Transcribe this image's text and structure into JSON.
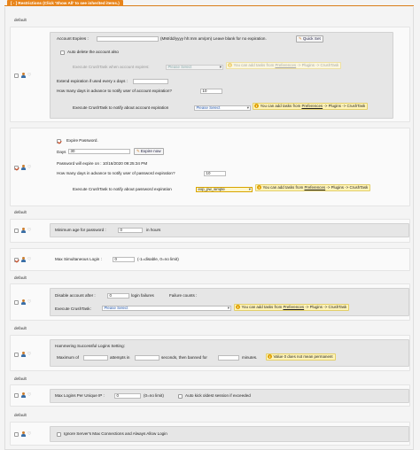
{
  "header": {
    "title": "[ - ] Restrictions (Click 'Show All' to see inherited items.)"
  },
  "labels": {
    "default": "default"
  },
  "expire": {
    "account_expires_label": "Account Expires :",
    "date_hint": "(MM/dd/yyyy hh:mm am/pm) Leave blank for no expiration.",
    "quick_set_label": "Quick Set",
    "auto_delete_label": "Auto delete the account also",
    "crushtask_when_expires_label": "Execute CrushTask when account expires:",
    "select_placeholder": "Please Select",
    "extend_label": "Extend expiration if used every x days :",
    "notify_days_label": "How many days in advance to notify user of account expiration?",
    "notify_days_value": "10",
    "crushtask_notify_label": "Execute CrushTask to notify about account expiration"
  },
  "tasks_note": {
    "pre": "You can add tasks from ",
    "link": "Preferences",
    "post": " -> Plugins -> CrushTask"
  },
  "password": {
    "expire_label": "Expire Password.",
    "days_label": "Days",
    "days_value": "30",
    "expire_now_label": "Expire now",
    "expire_on_text": "Password will expire on : 10/16/2020 09:25:34 PM",
    "notify_label": "How many days in advance to notify user of password expiration?",
    "notify_value": "10",
    "crushtask_label": "Execute CrushTask to notify about password expiration",
    "crushtask_value": "exp_pw_simple"
  },
  "min_age": {
    "label": "Minimum age for password :",
    "value": "0",
    "unit": "in hours"
  },
  "simultaneous": {
    "label": "Max Simultaneous Login :",
    "value": "0",
    "hint": "(-1=disable, 0=no limit)"
  },
  "disable": {
    "label": "Disable account after :",
    "value": "0",
    "suffix": "login failures",
    "failure_counts_label": "Failure counts :",
    "crushtask_label": "Execute CrushTask:",
    "crushtask_value": "Please Select"
  },
  "hammering": {
    "title": "Hammering Successful Logins Setting:",
    "max_label": "Maximum of",
    "attempts_label": "attempts in",
    "seconds_label": "seconds, then banned for",
    "minutes_label": "minutes.",
    "note": "Value 0 does not mean permanent"
  },
  "per_ip": {
    "label": "Max Logins Per Unique IP :",
    "value": "0",
    "hint": "(0=no limit)",
    "kick_label": "Auto kick oldest session if exceeded"
  },
  "ignore": {
    "label": "Ignore Server's Max Connections and Always Allow Login"
  }
}
